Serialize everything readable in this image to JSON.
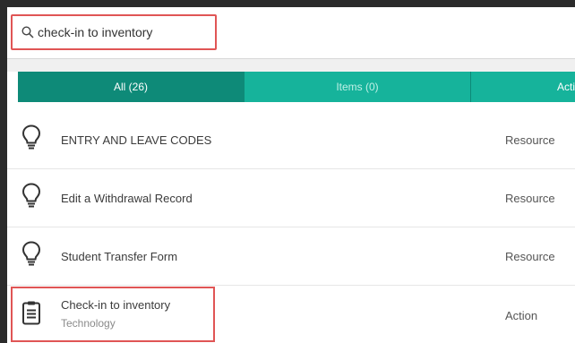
{
  "search": {
    "value": "check-in to inventory",
    "icon": "search-icon"
  },
  "tabs": [
    {
      "label": "All (26)",
      "active": true
    },
    {
      "label": "Items (0)",
      "active": false
    },
    {
      "label": "Acti",
      "active": false
    }
  ],
  "results": [
    {
      "title": "ENTRY AND LEAVE CODES",
      "type": "Resource",
      "icon": "lightbulb-icon"
    },
    {
      "title": "Edit a Withdrawal Record",
      "type": "Resource",
      "icon": "lightbulb-icon"
    },
    {
      "title": "Student Transfer Form",
      "type": "Resource",
      "icon": "lightbulb-icon"
    },
    {
      "title": "Check-in to inventory",
      "subtitle": "Technology",
      "type": "Action",
      "icon": "clipboard-icon"
    }
  ],
  "colors": {
    "highlight": "#e05555",
    "tab_active": "#0e8a78",
    "tab_inactive": "#16b39b"
  }
}
